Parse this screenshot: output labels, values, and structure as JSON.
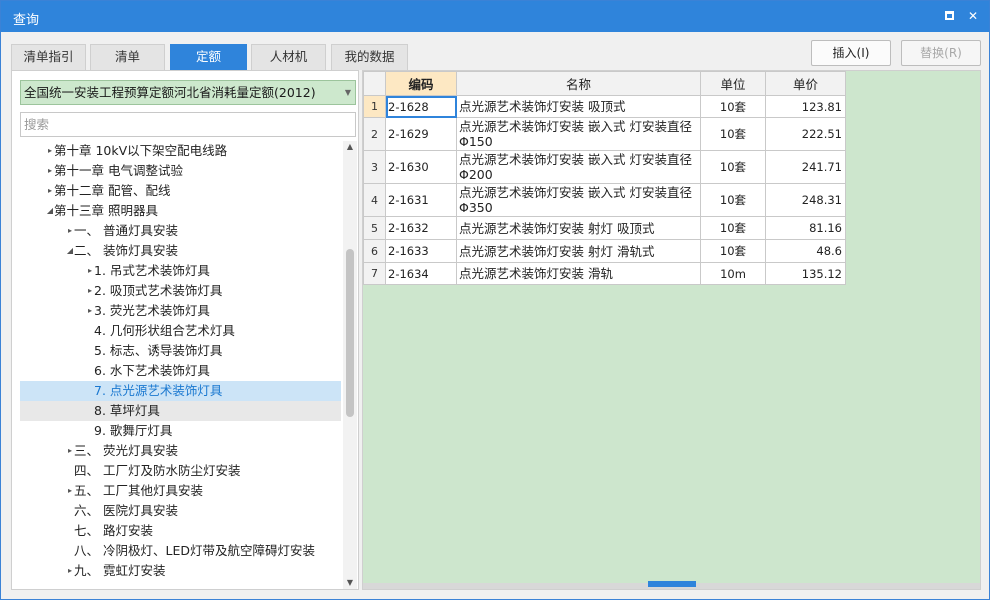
{
  "window": {
    "title": "查询"
  },
  "tabs": [
    {
      "label": "清单指引",
      "active": false
    },
    {
      "label": "清单",
      "active": false
    },
    {
      "label": "定额",
      "active": true
    },
    {
      "label": "人材机",
      "active": false
    },
    {
      "label": "我的数据",
      "active": false
    }
  ],
  "buttons": {
    "insert": "插入(I)",
    "replace": "替换(R)"
  },
  "library": {
    "selected": "全国统一安装工程预算定额河北省消耗量定额(2012)"
  },
  "search": {
    "placeholder": "搜索",
    "value": ""
  },
  "tree": [
    {
      "label": "第十章 10kV以下架空配电线路",
      "arrow": "▸"
    },
    {
      "label": "第十一章 电气调整试验",
      "arrow": "▸"
    },
    {
      "label": "第十二章 配管、配线",
      "arrow": "▸"
    },
    {
      "label": "第十三章 照明器具",
      "arrow": "◢"
    },
    {
      "label": "一、 普通灯具安装",
      "arrow": "▸"
    },
    {
      "label": "二、 装饰灯具安装",
      "arrow": "◢"
    },
    {
      "label": "1. 吊式艺术装饰灯具",
      "arrow": "▸"
    },
    {
      "label": "2. 吸顶式艺术装饰灯具",
      "arrow": "▸"
    },
    {
      "label": "3. 荧光艺术装饰灯具",
      "arrow": "▸"
    },
    {
      "label": "4. 几何形状组合艺术灯具",
      "arrow": ""
    },
    {
      "label": "5. 标志、诱导装饰灯具",
      "arrow": ""
    },
    {
      "label": "6. 水下艺术装饰灯具",
      "arrow": ""
    },
    {
      "label": "7. 点光源艺术装饰灯具",
      "arrow": ""
    },
    {
      "label": "8. 草坪灯具",
      "arrow": ""
    },
    {
      "label": "9. 歌舞厅灯具",
      "arrow": ""
    },
    {
      "label": "三、 荧光灯具安装",
      "arrow": "▸"
    },
    {
      "label": "四、 工厂灯及防水防尘灯安装",
      "arrow": ""
    },
    {
      "label": "五、 工厂其他灯具安装",
      "arrow": "▸"
    },
    {
      "label": "六、 医院灯具安装",
      "arrow": ""
    },
    {
      "label": "七、 路灯安装",
      "arrow": ""
    },
    {
      "label": "八、 冷阴极灯、LED灯带及航空障碍灯安装",
      "arrow": ""
    },
    {
      "label": "九、 霓虹灯安装",
      "arrow": "▸"
    }
  ],
  "grid": {
    "headers": {
      "code": "编码",
      "name": "名称",
      "unit": "单位",
      "price": "单价"
    },
    "rows": [
      {
        "no": "1",
        "code": "2-1628",
        "name": "点光源艺术装饰灯安装 吸顶式",
        "unit": "10套",
        "price": "123.81"
      },
      {
        "no": "2",
        "code": "2-1629",
        "name": "点光源艺术装饰灯安装 嵌入式 灯安装直径Φ150",
        "unit": "10套",
        "price": "222.51"
      },
      {
        "no": "3",
        "code": "2-1630",
        "name": "点光源艺术装饰灯安装 嵌入式 灯安装直径Φ200",
        "unit": "10套",
        "price": "241.71"
      },
      {
        "no": "4",
        "code": "2-1631",
        "name": "点光源艺术装饰灯安装 嵌入式 灯安装直径Φ350",
        "unit": "10套",
        "price": "248.31"
      },
      {
        "no": "5",
        "code": "2-1632",
        "name": "点光源艺术装饰灯安装 射灯 吸顶式",
        "unit": "10套",
        "price": "81.16"
      },
      {
        "no": "6",
        "code": "2-1633",
        "name": "点光源艺术装饰灯安装 射灯 滑轨式",
        "unit": "10套",
        "price": "48.6"
      },
      {
        "no": "7",
        "code": "2-1634",
        "name": "点光源艺术装饰灯安装 滑轨",
        "unit": "10m",
        "price": "135.12"
      }
    ]
  },
  "colors": {
    "accent": "#2f84db",
    "grid_bg": "#cde6cd",
    "selected_header": "#fde8c3"
  }
}
